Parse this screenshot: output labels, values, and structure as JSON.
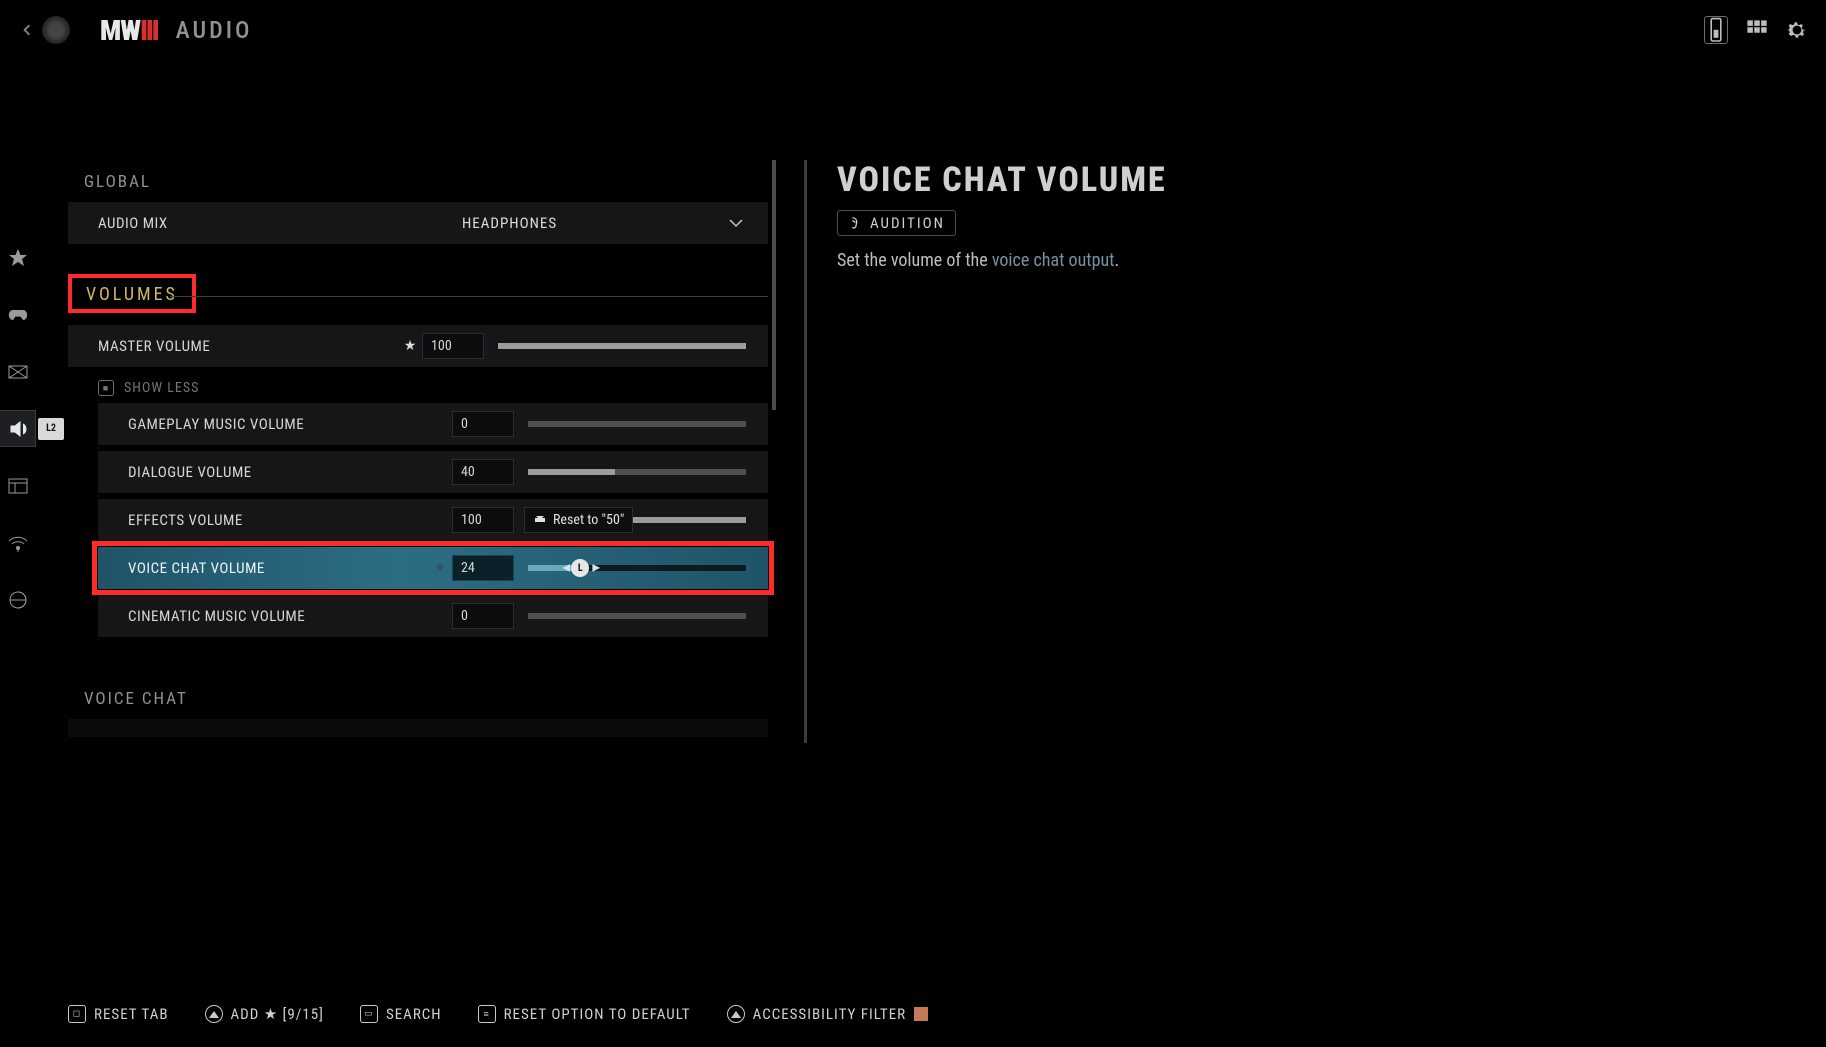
{
  "header": {
    "page_title": "AUDIO",
    "logo_mw": "MW",
    "logo_iii": "III"
  },
  "sidebar_badge": "L2",
  "sections": {
    "global": {
      "title": "GLOBAL",
      "audio_mix": {
        "label": "AUDIO MIX",
        "value": "HEADPHONES"
      }
    },
    "volumes": {
      "title": "VOLUMES",
      "master": {
        "label": "MASTER VOLUME",
        "value": "100",
        "pct": 100
      },
      "show_less": "SHOW LESS",
      "gameplay_music": {
        "label": "GAMEPLAY MUSIC VOLUME",
        "value": "0",
        "pct": 0
      },
      "dialogue": {
        "label": "DIALOGUE VOLUME",
        "value": "40",
        "pct": 40
      },
      "effects": {
        "label": "EFFECTS VOLUME",
        "value": "100",
        "pct": 100,
        "tooltip": "Reset to \"50\""
      },
      "voice_chat": {
        "label": "VOICE CHAT VOLUME",
        "value": "24",
        "pct": 24,
        "knob": "L"
      },
      "cinematic_music": {
        "label": "CINEMATIC MUSIC VOLUME",
        "value": "0",
        "pct": 0
      }
    },
    "voice_chat": {
      "title": "VOICE CHAT"
    }
  },
  "info": {
    "title": "VOICE CHAT VOLUME",
    "audition": "AUDITION",
    "desc_pre": "Set the volume of the ",
    "desc_link": "voice chat output",
    "desc_post": "."
  },
  "footer": {
    "reset_tab": "RESET TAB",
    "add": "ADD ★ [9/15]",
    "search": "SEARCH",
    "reset_default": "RESET OPTION TO DEFAULT",
    "accessibility": "ACCESSIBILITY FILTER"
  }
}
